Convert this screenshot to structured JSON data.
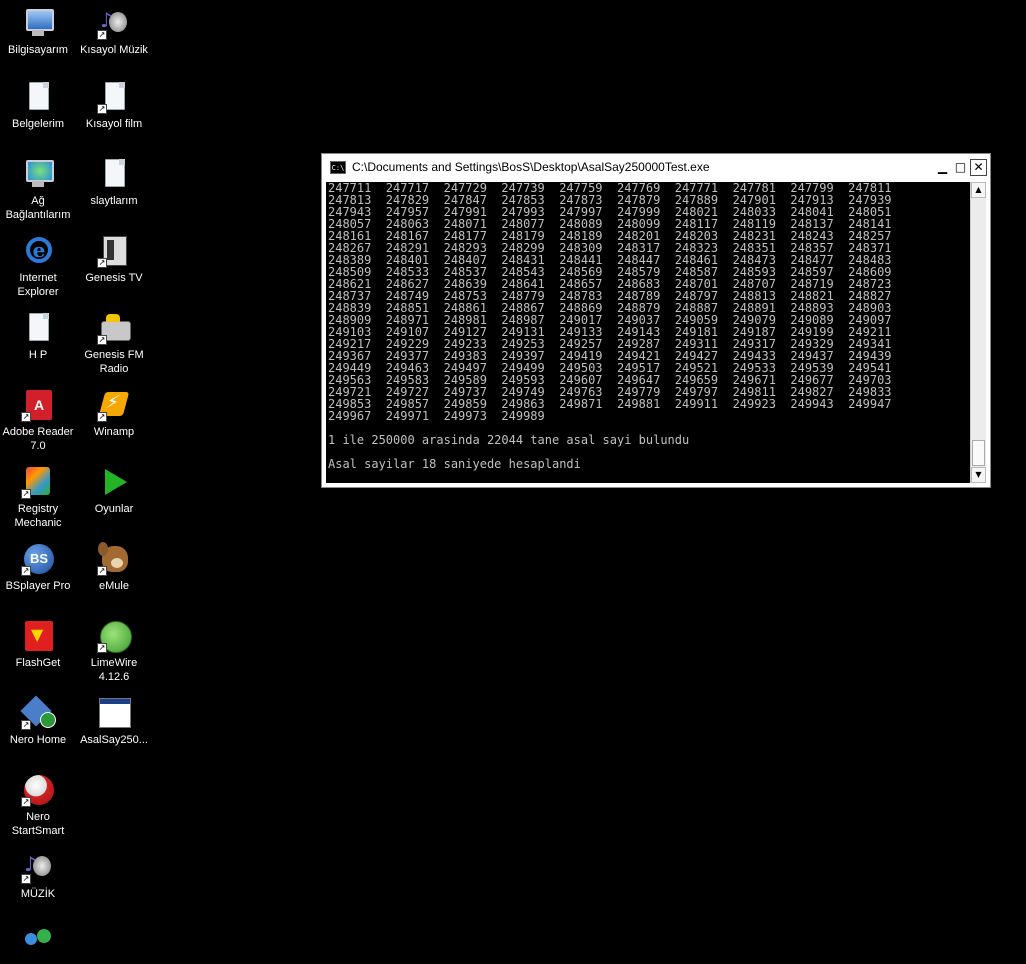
{
  "desktop": {
    "icons": [
      {
        "label": "Bilgisayarım",
        "icon": "my-computer-icon"
      },
      {
        "label": "Kısayol Müzik",
        "icon": "music-shortcut-icon"
      },
      {
        "label": "Belgelerim",
        "icon": "documents-icon"
      },
      {
        "label": "Kısayol film",
        "icon": "film-shortcut-icon"
      },
      {
        "label": "Ağ Bağlantılarım",
        "icon": "network-icon"
      },
      {
        "label": "slaytlarım",
        "icon": "slides-icon"
      },
      {
        "label": "Internet Explorer",
        "icon": "internet-explorer-icon"
      },
      {
        "label": "Genesis TV",
        "icon": "genesis-tv-icon"
      },
      {
        "label": "H P",
        "icon": "hp-folder-icon"
      },
      {
        "label": "Genesis FM Radio",
        "icon": "genesis-fm-radio-icon"
      },
      {
        "label": "Adobe Reader 7.0",
        "icon": "adobe-reader-icon"
      },
      {
        "label": "Winamp",
        "icon": "winamp-icon"
      },
      {
        "label": "Registry Mechanic",
        "icon": "registry-mechanic-icon"
      },
      {
        "label": "Oyunlar",
        "icon": "games-icon"
      },
      {
        "label": "BSplayer Pro",
        "icon": "bsplayer-icon"
      },
      {
        "label": "eMule",
        "icon": "emule-icon"
      },
      {
        "label": "FlashGet",
        "icon": "flashget-icon"
      },
      {
        "label": "LimeWire 4.12.6",
        "icon": "limewire-icon"
      },
      {
        "label": "Nero Home",
        "icon": "nero-home-icon"
      },
      {
        "label": "AsalSay250...",
        "icon": "application-icon"
      },
      {
        "label": "Nero StartSmart",
        "icon": "nero-startsmart-icon"
      },
      {
        "label": "MÜZİK",
        "icon": "music-icon"
      },
      {
        "label": "",
        "icon": "users-icon"
      }
    ]
  },
  "console": {
    "title": "C:\\Documents and Settings\\BosS\\Desktop\\AsalSay250000Test.exe",
    "app_icon_text": "C:\\",
    "buttons": {
      "minimize": "▁",
      "maximize": "□",
      "close": "✕"
    },
    "output": "247711  247717  247729  247739  247759  247769  247771  247781  247799  247811\n247813  247829  247847  247853  247873  247879  247889  247901  247913  247939\n247943  247957  247991  247993  247997  247999  248021  248033  248041  248051\n248057  248063  248071  248077  248089  248099  248117  248119  248137  248141\n248161  248167  248177  248179  248189  248201  248203  248231  248243  248257\n248267  248291  248293  248299  248309  248317  248323  248351  248357  248371\n248389  248401  248407  248431  248441  248447  248461  248473  248477  248483\n248509  248533  248537  248543  248569  248579  248587  248593  248597  248609\n248621  248627  248639  248641  248657  248683  248701  248707  248719  248723\n248737  248749  248753  248779  248783  248789  248797  248813  248821  248827\n248839  248851  248861  248867  248869  248879  248887  248891  248893  248903\n248909  248971  248981  248987  249017  249037  249059  249079  249089  249097\n249103  249107  249127  249131  249133  249143  249181  249187  249199  249211\n249217  249229  249233  249253  249257  249287  249311  249317  249329  249341\n249367  249377  249383  249397  249419  249421  249427  249433  249437  249439\n249449  249463  249497  249499  249503  249517  249521  249533  249539  249541\n249563  249583  249589  249593  249607  249647  249659  249671  249677  249703\n249721  249727  249737  249749  249763  249779  249797  249811  249827  249833\n249853  249857  249859  249863  249871  249881  249911  249923  249943  249947\n249967  249971  249973  249989\n\n1 ile 250000 arasinda 22044 tane asal sayi bulundu\n\nAsal sayilar 18 saniyede hesaplandi"
  }
}
